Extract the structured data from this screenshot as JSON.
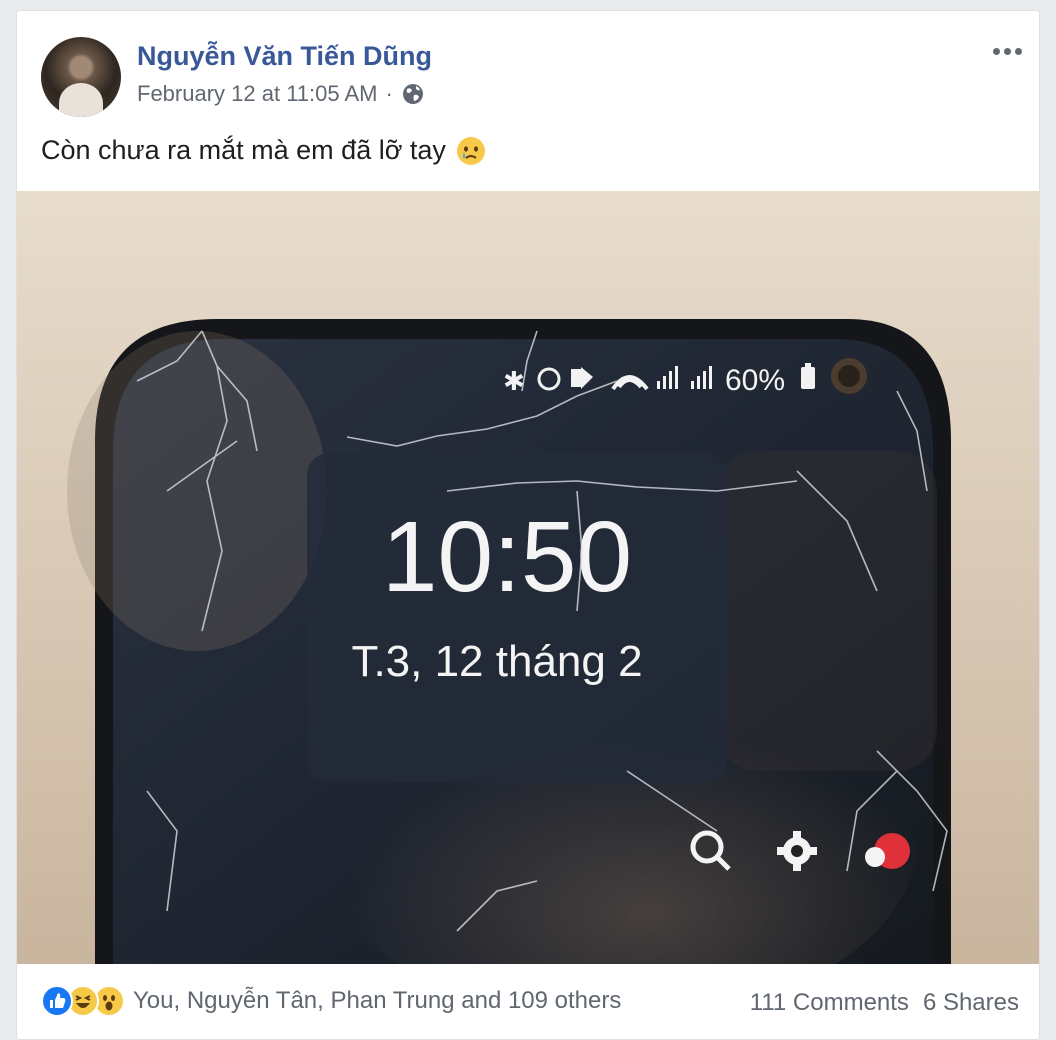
{
  "post": {
    "author": "Nguyễn Văn Tiến Dũng",
    "timestamp": "February 12 at 11:05 AM",
    "separator": "·",
    "privacy_icon": "globe-icon",
    "caption": "Còn chưa ra mắt mà em đã lỡ tay",
    "caption_emoji": "crying-face-emoji"
  },
  "photo": {
    "status_bar": {
      "icons": [
        "bluetooth-icon",
        "alarm-icon",
        "mute-icon",
        "wifi-icon",
        "signal-icon",
        "battery-icon"
      ],
      "battery": "60%"
    },
    "clock": "10:50",
    "date": "T.3, 12 tháng 2"
  },
  "engagement": {
    "reaction_icons": [
      "like-icon",
      "haha-icon",
      "wow-icon"
    ],
    "reactors": "You, Nguyễn Tân, Phan Trung and 109 others",
    "comments": "111 Comments",
    "shares": "6 Shares"
  },
  "colors": {
    "author_link": "#385898",
    "secondary_text": "#606770",
    "like_blue": "#1877f2",
    "emoji_yellow": "#f7c948"
  }
}
